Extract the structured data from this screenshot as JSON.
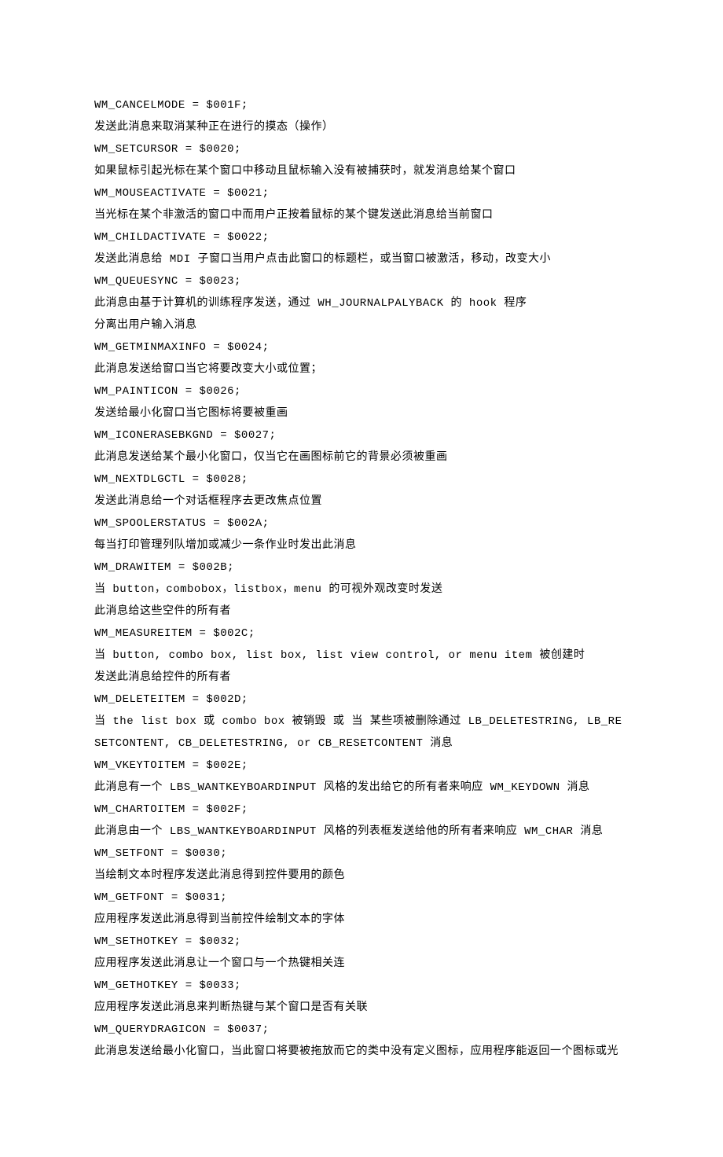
{
  "lines": [
    "WM_CANCELMODE = $001F;",
    "发送此消息来取消某种正在进行的摸态（操作）",
    "WM_SETCURSOR = $0020;",
    "如果鼠标引起光标在某个窗口中移动且鼠标输入没有被捕获时，就发消息给某个窗口",
    "WM_MOUSEACTIVATE = $0021;",
    "当光标在某个非激活的窗口中而用户正按着鼠标的某个键发送此消息给当前窗口",
    "WM_CHILDACTIVATE = $0022;",
    "发送此消息给 MDI 子窗口当用户点击此窗口的标题栏，或当窗口被激活，移动，改变大小",
    "WM_QUEUESYNC = $0023;",
    "此消息由基于计算机的训练程序发送，通过 WH_JOURNALPALYBACK 的 hook 程序",
    "分离出用户输入消息",
    "WM_GETMINMAXINFO = $0024;",
    "此消息发送给窗口当它将要改变大小或位置；",
    "WM_PAINTICON = $0026;",
    "发送给最小化窗口当它图标将要被重画",
    "WM_ICONERASEBKGND = $0027;",
    "此消息发送给某个最小化窗口，仅当它在画图标前它的背景必须被重画",
    "WM_NEXTDLGCTL = $0028;",
    "发送此消息给一个对话框程序去更改焦点位置",
    "WM_SPOOLERSTATUS = $002A;",
    "每当打印管理列队增加或减少一条作业时发出此消息",
    "WM_DRAWITEM = $002B;",
    "当 button，combobox，listbox，menu 的可视外观改变时发送",
    "此消息给这些空件的所有者",
    "WM_MEASUREITEM = $002C;",
    "当 button, combo box, list box, list view control, or menu item 被创建时",
    "发送此消息给控件的所有者",
    "WM_DELETEITEM = $002D;",
    "当 the list box 或 combo box 被销毁 或 当 某些项被删除通过 LB_DELETESTRING, LB_RESETCONTENT, CB_DELETESTRING, or CB_RESETCONTENT 消息",
    "WM_VKEYTOITEM = $002E;",
    "此消息有一个 LBS_WANTKEYBOARDINPUT 风格的发出给它的所有者来响应 WM_KEYDOWN 消息",
    "WM_CHARTOITEM = $002F;",
    "此消息由一个 LBS_WANTKEYBOARDINPUT 风格的列表框发送给他的所有者来响应 WM_CHAR 消息",
    "WM_SETFONT = $0030;",
    "当绘制文本时程序发送此消息得到控件要用的颜色",
    "WM_GETFONT = $0031;",
    "应用程序发送此消息得到当前控件绘制文本的字体",
    "WM_SETHOTKEY = $0032;",
    "应用程序发送此消息让一个窗口与一个热键相关连",
    "WM_GETHOTKEY = $0033;",
    "应用程序发送此消息来判断热键与某个窗口是否有关联",
    "WM_QUERYDRAGICON = $0037;",
    "此消息发送给最小化窗口，当此窗口将要被拖放而它的类中没有定义图标，应用程序能返回一个图标或光"
  ]
}
